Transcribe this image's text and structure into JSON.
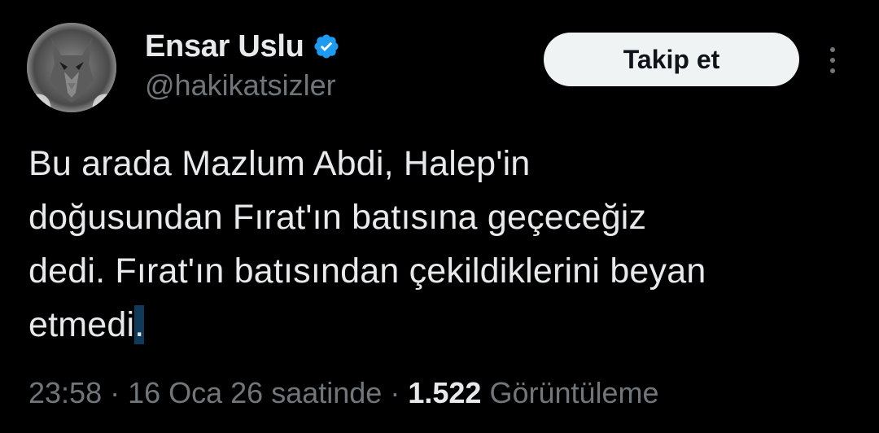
{
  "profile": {
    "avatar_icon": "wolf-avatar",
    "display_name": "Ensar Uslu",
    "verified_icon": "verified-badge-icon",
    "handle": "@hakikatsizler"
  },
  "actions": {
    "follow_label": "Takip et",
    "more_icon": "more-vertical-icon"
  },
  "tweet": {
    "lines": [
      "Bu arada Mazlum Abdi, Halep'in",
      "doğusundan Fırat'ın batısına geçeceğiz",
      "dedi. Fırat'ın batısından çekildiklerini beyan",
      "etmedi"
    ],
    "selected_char": "."
  },
  "meta": {
    "time": "23:58",
    "separator": " · ",
    "date": "16 Oca 26 saatinde",
    "views_count": "1.522",
    "views_label": "Görüntüleme"
  },
  "colors": {
    "background": "#000000",
    "text": "#e7e9ea",
    "secondary": "#71767b",
    "verified": "#1d9bf0",
    "button_bg": "#eff3f4",
    "selection": "#0f3a5a"
  }
}
